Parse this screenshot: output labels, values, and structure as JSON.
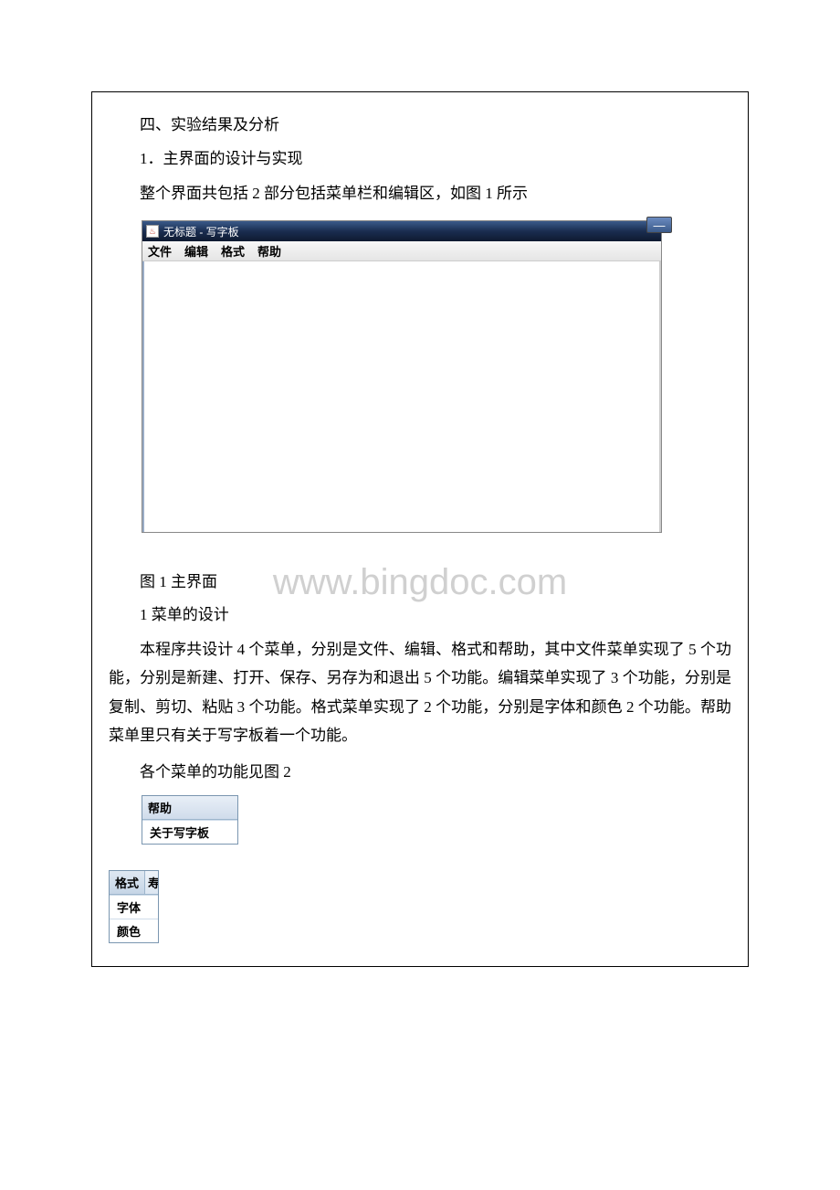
{
  "section_heading": "四、实验结果及分析",
  "subsection_1": "1．主界面的设计与实现",
  "intro_line": "整个界面共包括 2 部分包括菜单栏和编辑区，如图 1 所示",
  "window": {
    "title": "无标题 - 写字板",
    "minimize_glyph": "—",
    "menus": [
      "文件",
      "编辑",
      "格式",
      "帮助"
    ]
  },
  "watermark": "www.bingdoc.com",
  "figure1_caption": "图 1 主界面",
  "subsection_2": "1 菜单的设计",
  "body_paragraph": "本程序共设计 4 个菜单，分别是文件、编辑、格式和帮助，其中文件菜单实现了 5 个功能，分别是新建、打开、保存、另存为和退出 5 个功能。编辑菜单实现了 3 个功能，分别是复制、剪切、粘贴 3 个功能。格式菜单实现了 2 个功能，分别是字体和颜色 2 个功能。帮助菜单里只有关于写字板着一个功能。",
  "body_line2": "各个菜单的功能见图 2",
  "help_menu": {
    "header": "帮助",
    "items": [
      "关于写字板"
    ]
  },
  "format_menu": {
    "header_a": "格式",
    "header_b": "寿",
    "items": [
      "字体",
      "颜色"
    ]
  }
}
